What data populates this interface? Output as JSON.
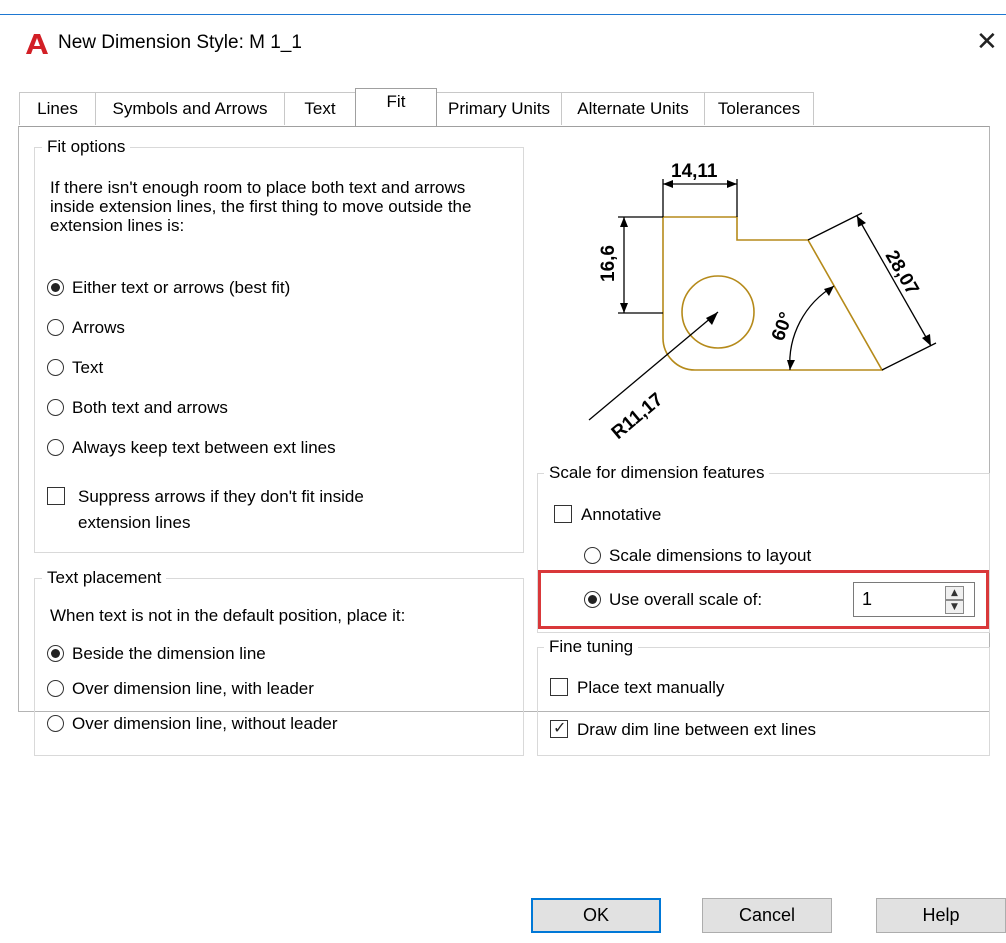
{
  "window": {
    "title": "New Dimension Style: M 1_1",
    "app_icon": "autocad-a-icon",
    "close_glyph": "✕"
  },
  "tabs": [
    {
      "label": "Lines",
      "active": false
    },
    {
      "label": "Symbols and Arrows",
      "active": false
    },
    {
      "label": "Text",
      "active": false
    },
    {
      "label": "Fit",
      "active": true
    },
    {
      "label": "Primary Units",
      "active": false
    },
    {
      "label": "Alternate Units",
      "active": false
    },
    {
      "label": "Tolerances",
      "active": false
    }
  ],
  "fit_options": {
    "title": "Fit options",
    "description": "If there isn't enough room to place both text and arrows inside extension lines, the first thing to move outside the extension lines is:",
    "options": [
      {
        "label": "Either text or arrows (best fit)",
        "checked": true
      },
      {
        "label": "Arrows",
        "checked": false
      },
      {
        "label": "Text",
        "checked": false
      },
      {
        "label": "Both text and arrows",
        "checked": false
      },
      {
        "label": "Always keep text between ext lines",
        "checked": false
      }
    ],
    "suppress": {
      "label_line1": "Suppress arrows if they don't fit inside",
      "label_line2": "extension lines",
      "checked": false
    }
  },
  "text_placement": {
    "title": "Text placement",
    "description": "When text is not in the default position, place it:",
    "options": [
      {
        "label": "Beside the dimension line",
        "checked": true
      },
      {
        "label": "Over dimension line, with leader",
        "checked": false
      },
      {
        "label": "Over dimension line, without leader",
        "checked": false
      }
    ]
  },
  "preview": {
    "dim_top": "14,11",
    "dim_left": "16,6",
    "dim_right": "28,07",
    "dim_angle": "60°",
    "dim_radius": "R11,17",
    "line_color": "#b58a1a"
  },
  "scale": {
    "title": "Scale for dimension features",
    "annotative": {
      "label": "Annotative",
      "checked": false
    },
    "scale_to_layout": {
      "label": "Scale dimensions to layout",
      "checked": false
    },
    "overall_scale": {
      "label": "Use overall scale of:",
      "checked": true,
      "value": "1"
    },
    "highlight_color": "#d9383a"
  },
  "fine_tuning": {
    "title": "Fine tuning",
    "place_manually": {
      "label": "Place text manually",
      "checked": false
    },
    "draw_dim_line": {
      "label": "Draw dim line between ext lines",
      "checked": true
    }
  },
  "buttons": {
    "ok": "OK",
    "cancel": "Cancel",
    "help": "Help"
  }
}
